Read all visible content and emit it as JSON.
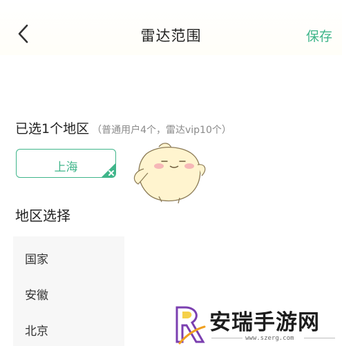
{
  "header": {
    "title": "雷达范围",
    "save_label": "保存"
  },
  "selected": {
    "title": "已选1个地区",
    "hint": "（普通用户4个，雷达vip10个）",
    "chips": [
      {
        "label": "上海"
      }
    ]
  },
  "regions": {
    "title": "地区选择",
    "items": [
      {
        "label": "国家"
      },
      {
        "label": "安徽"
      },
      {
        "label": "北京"
      }
    ]
  },
  "watermark": {
    "brand": "安瑞手游网",
    "url": "www.szerg.com"
  },
  "colors": {
    "accent": "#3fb58a",
    "list_bg": "#f7f7f7"
  }
}
